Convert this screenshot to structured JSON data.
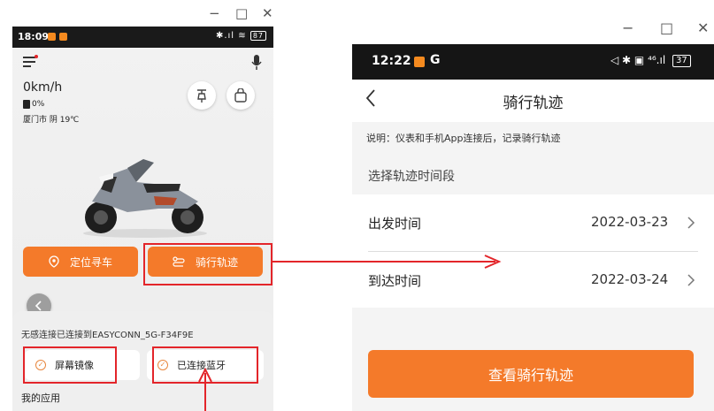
{
  "window_controls": {
    "minimize": "−",
    "maximize": "□",
    "close": "✕"
  },
  "left": {
    "status_time": "18:09",
    "status_right": "✱.ıl ≋",
    "battery": "87",
    "speed": "0km/h",
    "fuel": "0%",
    "weather": "厦门市 阴 19℃",
    "locate_button": "定位寻车",
    "track_button": "骑行轨迹",
    "connection_notice": "无感连接已连接到EASYCONN_5G-F34F9E",
    "screen_mirror": "屏幕镜像",
    "bluetooth": "已连接蓝牙",
    "my_apps": "我的应用",
    "brand_color": "#f47a2a"
  },
  "right": {
    "status_time": "12:22",
    "status_g": "G",
    "status_icons": "◁ ✱ ▣ ⁴⁶.ıl",
    "battery": "37",
    "back_icon": "chevron-left",
    "title": "骑行轨迹",
    "description": "说明：仪表和手机App连接后，记录骑行轨迹",
    "section_title": "选择轨迹时间段",
    "departure_label": "出发时间",
    "departure_value": "2022-03-23",
    "arrival_label": "到达时间",
    "arrival_value": "2022-03-24",
    "view_button": "查看骑行轨迹",
    "brand_color": "#f47a2a"
  },
  "annotation_color": "#e3252a"
}
